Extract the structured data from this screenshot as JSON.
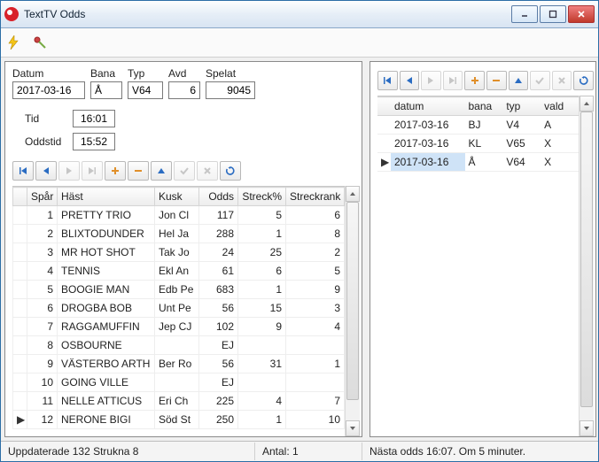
{
  "window": {
    "title": "TextTV Odds"
  },
  "filters": {
    "datum_label": "Datum",
    "datum": "2017-03-16",
    "bana_label": "Bana",
    "bana": "Å",
    "typ_label": "Typ",
    "typ": "V64",
    "avd_label": "Avd",
    "avd": "6",
    "spelat_label": "Spelat",
    "spelat": "9045",
    "tid_label": "Tid",
    "tid": "16:01",
    "oddstid_label": "Oddstid",
    "oddstid": "15:52"
  },
  "left_grid": {
    "headers": {
      "spar": "Spår",
      "hast": "Häst",
      "kusk": "Kusk",
      "odds": "Odds",
      "streckp": "Streck%",
      "streckrank": "Streckrank"
    },
    "rows": [
      {
        "spar": 1,
        "hast": "PRETTY TRIO",
        "kusk": "Jon Cl",
        "odds": "117",
        "streckp": "5",
        "streckrank": "6"
      },
      {
        "spar": 2,
        "hast": "BLIXTODUNDER",
        "kusk": "Hel Ja",
        "odds": "288",
        "streckp": "1",
        "streckrank": "8"
      },
      {
        "spar": 3,
        "hast": "MR HOT SHOT",
        "kusk": "Tak Jo",
        "odds": "24",
        "streckp": "25",
        "streckrank": "2"
      },
      {
        "spar": 4,
        "hast": "TENNIS",
        "kusk": "Ekl An",
        "odds": "61",
        "streckp": "6",
        "streckrank": "5"
      },
      {
        "spar": 5,
        "hast": "BOOGIE MAN",
        "kusk": "Edb Pe",
        "odds": "683",
        "streckp": "1",
        "streckrank": "9"
      },
      {
        "spar": 6,
        "hast": "DROGBA BOB",
        "kusk": "Unt Pe",
        "odds": "56",
        "streckp": "15",
        "streckrank": "3"
      },
      {
        "spar": 7,
        "hast": "RAGGAMUFFIN",
        "kusk": "Jep CJ",
        "odds": "102",
        "streckp": "9",
        "streckrank": "4"
      },
      {
        "spar": 8,
        "hast": "OSBOURNE",
        "kusk": "",
        "odds": "EJ",
        "streckp": "",
        "streckrank": ""
      },
      {
        "spar": 9,
        "hast": "VÄSTERBO ARTH",
        "kusk": "Ber Ro",
        "odds": "56",
        "streckp": "31",
        "streckrank": "1"
      },
      {
        "spar": 10,
        "hast": "GOING VILLE",
        "kusk": "",
        "odds": "EJ",
        "streckp": "",
        "streckrank": ""
      },
      {
        "spar": 11,
        "hast": "NELLE ATTICUS",
        "kusk": "Eri Ch",
        "odds": "225",
        "streckp": "4",
        "streckrank": "7"
      },
      {
        "spar": 12,
        "hast": "NERONE BIGI",
        "kusk": "Söd St",
        "odds": "250",
        "streckp": "1",
        "streckrank": "10"
      }
    ],
    "active_index": 11
  },
  "right_grid": {
    "headers": {
      "datum": "datum",
      "bana": "bana",
      "typ": "typ",
      "vald": "vald"
    },
    "rows": [
      {
        "datum": "2017-03-16",
        "bana": "BJ",
        "typ": "V4",
        "vald": "A"
      },
      {
        "datum": "2017-03-16",
        "bana": "KL",
        "typ": "V65",
        "vald": "X"
      },
      {
        "datum": "2017-03-16",
        "bana": "Å",
        "typ": "V64",
        "vald": "X"
      }
    ],
    "active_index": 2
  },
  "status": {
    "left": "Uppdaterade 132 Strukna 8",
    "antal": "Antal: 1",
    "right": "Nästa odds 16:07.  Om 5 minuter."
  }
}
